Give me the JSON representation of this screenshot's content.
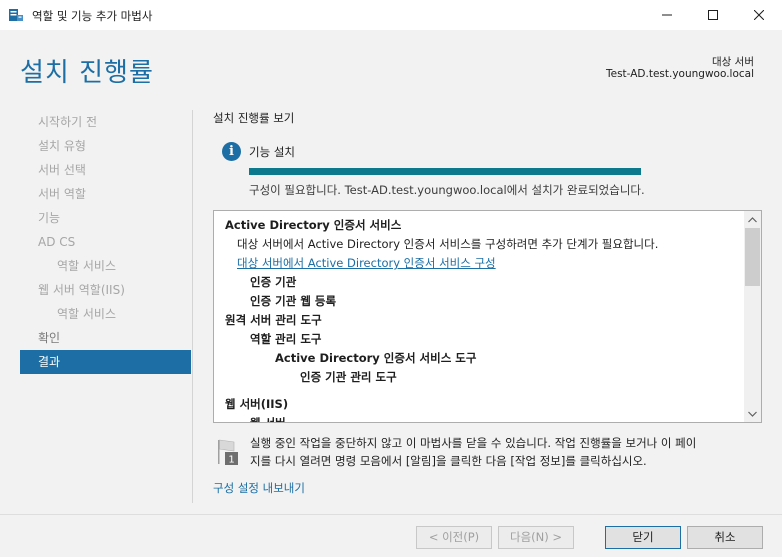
{
  "window": {
    "title": "역할 및 기능 추가 마법사",
    "icons": {
      "app": "server-manager-icon",
      "minimize": "minimize-icon",
      "maximize": "maximize-icon",
      "close": "close-icon"
    }
  },
  "header": {
    "page_title": "설치 진행률",
    "dest_label": "대상 서버",
    "dest_server": "Test-AD.test.youngwoo.local"
  },
  "nav": {
    "items": [
      {
        "label": "시작하기 전"
      },
      {
        "label": "설치 유형"
      },
      {
        "label": "서버 선택"
      },
      {
        "label": "서버 역할"
      },
      {
        "label": "기능"
      },
      {
        "label": "AD CS"
      },
      {
        "label": "역할 서비스"
      },
      {
        "label": "웹 서버 역할(IIS)"
      },
      {
        "label": "역할 서비스"
      },
      {
        "label": "확인"
      },
      {
        "label": "결과"
      }
    ]
  },
  "main": {
    "view_label": "설치 진행률 보기",
    "feature_install": "기능 설치",
    "progress": 1.0,
    "status_message": "구성이 필요합니다. Test-AD.test.youngwoo.local에서 설치가 완료되었습니다.",
    "results": [
      {
        "text": "Active Directory 인증서 서비스"
      },
      {
        "text": "대상 서버에서 Active Directory 인증서 서비스를 구성하려면 추가 단계가 필요합니다."
      },
      {
        "text": "대상 서버에서 Active Directory 인증서 서비스 구성"
      },
      {
        "text": "인증 기관"
      },
      {
        "text": "인증 기관 웹 등록"
      },
      {
        "text": "원격 서버 관리 도구"
      },
      {
        "text": "역할 관리 도구"
      },
      {
        "text": "Active Directory 인증서 서비스 도구"
      },
      {
        "text": "인증 기관 관리 도구"
      },
      {
        "text": "웹 서버(IIS)"
      },
      {
        "text": "웹 서버"
      }
    ],
    "notice_line1": "실행 중인 작업을 중단하지 않고 이 마법사를 닫을 수 있습니다. 작업 진행률을 보거나 이 페이",
    "notice_line2": "지를 다시 열려면 명령 모음에서 [알림]을 클릭한 다음 [작업 정보]를 클릭하십시오.",
    "notice_badge": "1",
    "export_link": "구성 설정 내보내기"
  },
  "footer": {
    "prev": "< 이전(P)",
    "next": "다음(N) >",
    "close": "닫기",
    "cancel": "취소"
  },
  "colors": {
    "accent": "#1c6ea4",
    "progress": "#0c7a8c",
    "panel_bg": "#f2f2f2"
  }
}
